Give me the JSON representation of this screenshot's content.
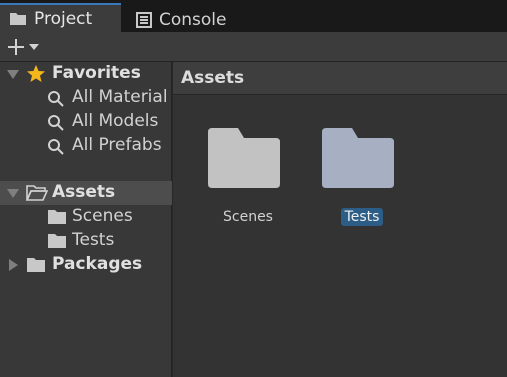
{
  "tabs": [
    {
      "label": "Project",
      "icon": "folder-icon"
    },
    {
      "label": "Console",
      "icon": "console-icon"
    }
  ],
  "toolbar": {
    "add_label": "+"
  },
  "sidebar": {
    "favorites": {
      "label": "Favorites",
      "items": [
        {
          "label": "All Material",
          "icon": "search-icon"
        },
        {
          "label": "All Models",
          "icon": "search-icon"
        },
        {
          "label": "All Prefabs",
          "icon": "search-icon"
        }
      ]
    },
    "assets": {
      "label": "Assets",
      "children": [
        {
          "label": "Scenes",
          "icon": "folder-icon"
        },
        {
          "label": "Tests",
          "icon": "folder-icon"
        }
      ]
    },
    "packages": {
      "label": "Packages"
    }
  },
  "main": {
    "title": "Assets",
    "items": [
      {
        "label": "Scenes",
        "selected": false
      },
      {
        "label": "Tests",
        "selected": true
      }
    ]
  },
  "colors": {
    "accent": "#3a79bb",
    "selection": "#2c5d87",
    "star": "#f4b71b",
    "folder": "#c2c2c2",
    "folder_selected": "#a7afc2"
  }
}
